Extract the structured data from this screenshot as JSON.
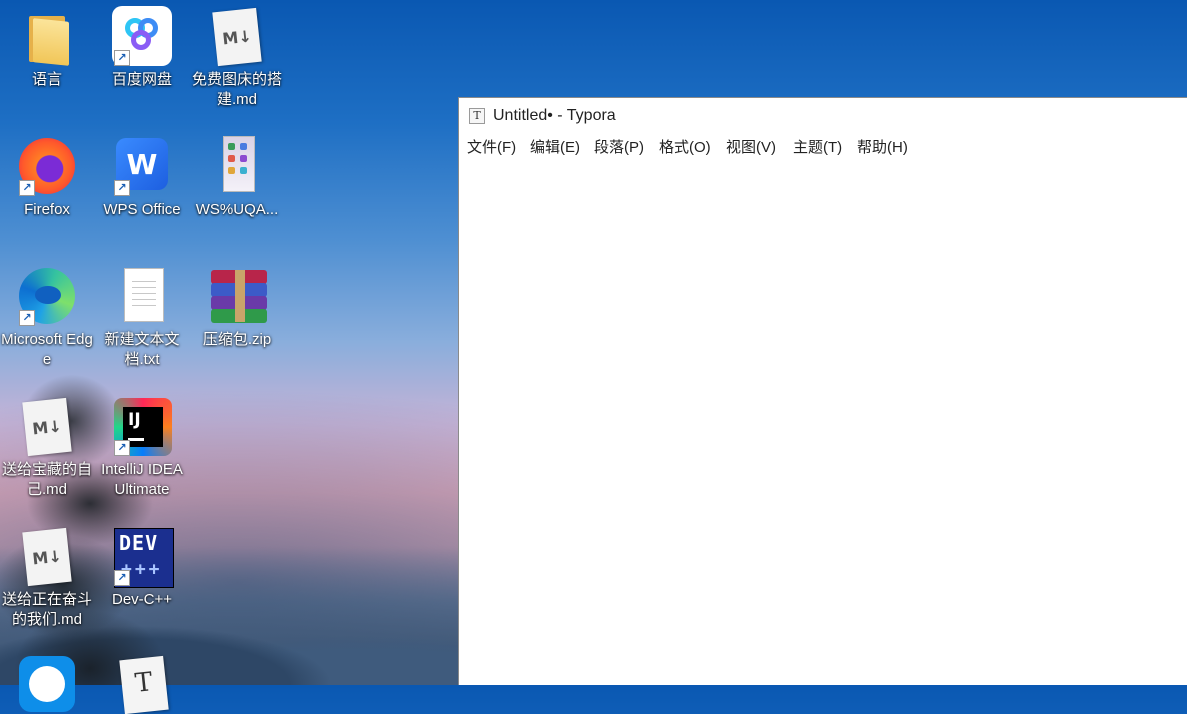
{
  "desktop": {
    "icons": [
      {
        "label": "语言"
      },
      {
        "label": "百度网盘"
      },
      {
        "label": "免费图床的搭建.md"
      },
      {
        "label": "Firefox"
      },
      {
        "label": "WPS Office"
      },
      {
        "label": "WS%UQA..."
      },
      {
        "label": "Microsoft Edge"
      },
      {
        "label": "新建文本文档.txt"
      },
      {
        "label": "压缩包.zip"
      },
      {
        "label": "送给宝藏的自己.md"
      },
      {
        "label": "IntelliJ IDEA Ultimate"
      },
      {
        "label": "送给正在奋斗的我们.md"
      },
      {
        "label": "Dev-C++"
      }
    ],
    "glyphs": {
      "md": "M↓",
      "wps": "W",
      "ij": "IJ",
      "dev_title": "DEV",
      "dev_sub": "+++",
      "typora": "T",
      "shortcut_arrow": "↗"
    }
  },
  "window": {
    "title": "Untitled• - Typora",
    "app_icon_glyph": "T",
    "menu": [
      {
        "label": "文件(F)"
      },
      {
        "label": "编辑(E)"
      },
      {
        "label": "段落(P)"
      },
      {
        "label": "格式(O)"
      },
      {
        "label": "视图(V)"
      },
      {
        "label": "主题(T)"
      },
      {
        "label": "帮助(H)"
      }
    ]
  }
}
